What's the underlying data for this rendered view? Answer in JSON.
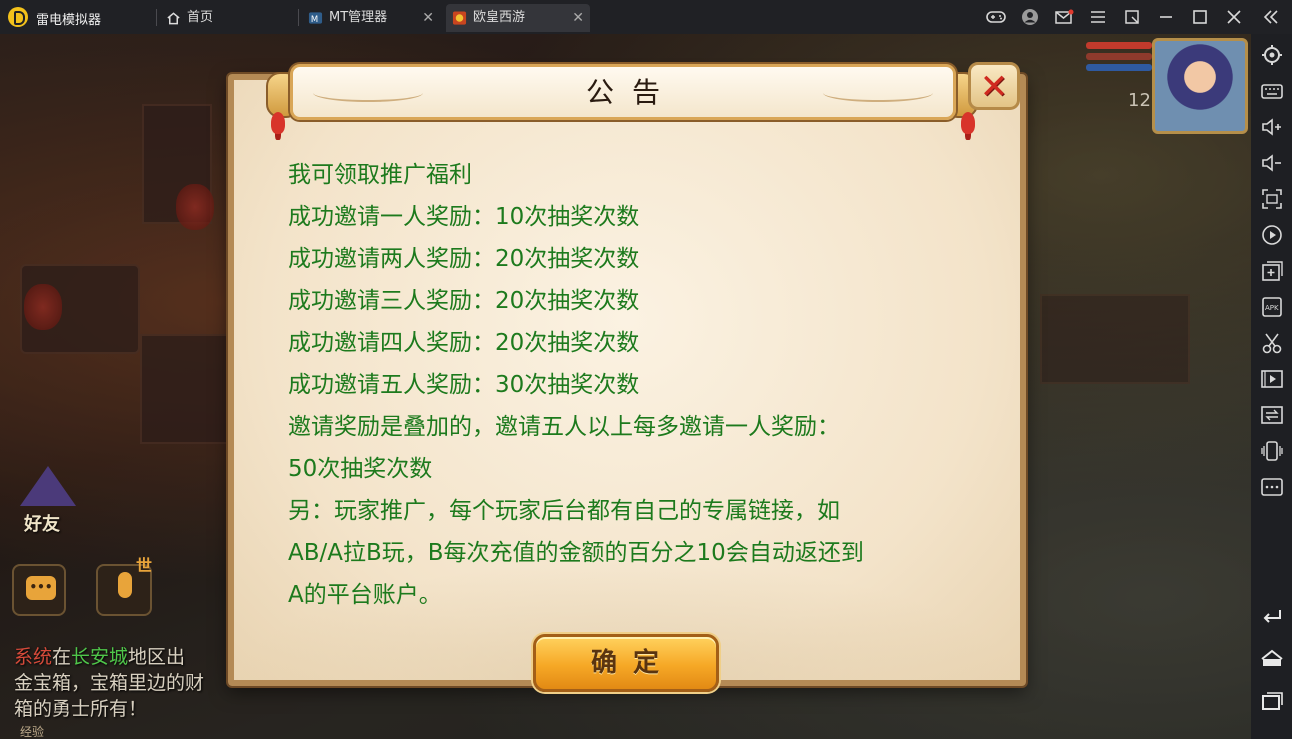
{
  "app": {
    "name": "雷电模拟器"
  },
  "tabs": [
    {
      "label": "首页",
      "icon": "home-icon"
    },
    {
      "label": "MT管理器",
      "icon": "mt-app-icon"
    },
    {
      "label": "欧皇西游",
      "icon": "game-app-icon",
      "active": true
    }
  ],
  "tab_close_glyph": "✕",
  "window_controls": [
    "gamepad-icon",
    "account-icon",
    "mail-icon",
    "menu-icon",
    "pin-window-icon",
    "minimize-icon",
    "maximize-icon",
    "close-icon",
    "collapse-sidebar-icon"
  ],
  "sidebar": [
    "settings-icon",
    "keyboard-icon",
    "volume-up-icon",
    "volume-down-icon",
    "screenshot-icon",
    "screen-record-icon",
    "multi-instance-icon",
    "apk-install-icon",
    "scissors-icon",
    "video-icon",
    "sync-icon",
    "shake-icon",
    "more-icon",
    "back-icon",
    "home-nav-icon",
    "recent-apps-icon"
  ],
  "game": {
    "level": "12",
    "friend_label": "好友",
    "world_label": "世",
    "chat": {
      "sys_tag": "系统",
      "prefix": "在",
      "city": "长安城",
      "line1_rest": "地区出",
      "line2": "金宝箱，宝箱里边的财",
      "line3": "箱的勇士所有！"
    },
    "exp_label": "经验"
  },
  "dialog": {
    "title": "公告",
    "close_glyph": "✕",
    "ok_label": "确定",
    "lines": [
      "我可领取推广福利",
      "成功邀请一人奖励：10次抽奖次数",
      "成功邀请两人奖励：20次抽奖次数",
      "成功邀请三人奖励：20次抽奖次数",
      "成功邀请四人奖励：20次抽奖次数",
      "成功邀请五人奖励：30次抽奖次数",
      "邀请奖励是叠加的，邀请五人以上每多邀请一人奖励：",
      "50次抽奖次数",
      "另：玩家推广，每个玩家后台都有自己的专属链接，如",
      "AB/A拉B玩，B每次充值的金额的百分之10会自动返还到",
      "A的平台账户。"
    ]
  },
  "colors": {
    "notice_text": "#1d7a1d",
    "close_x": "#d02a20",
    "ok_button": "#f6a826"
  }
}
